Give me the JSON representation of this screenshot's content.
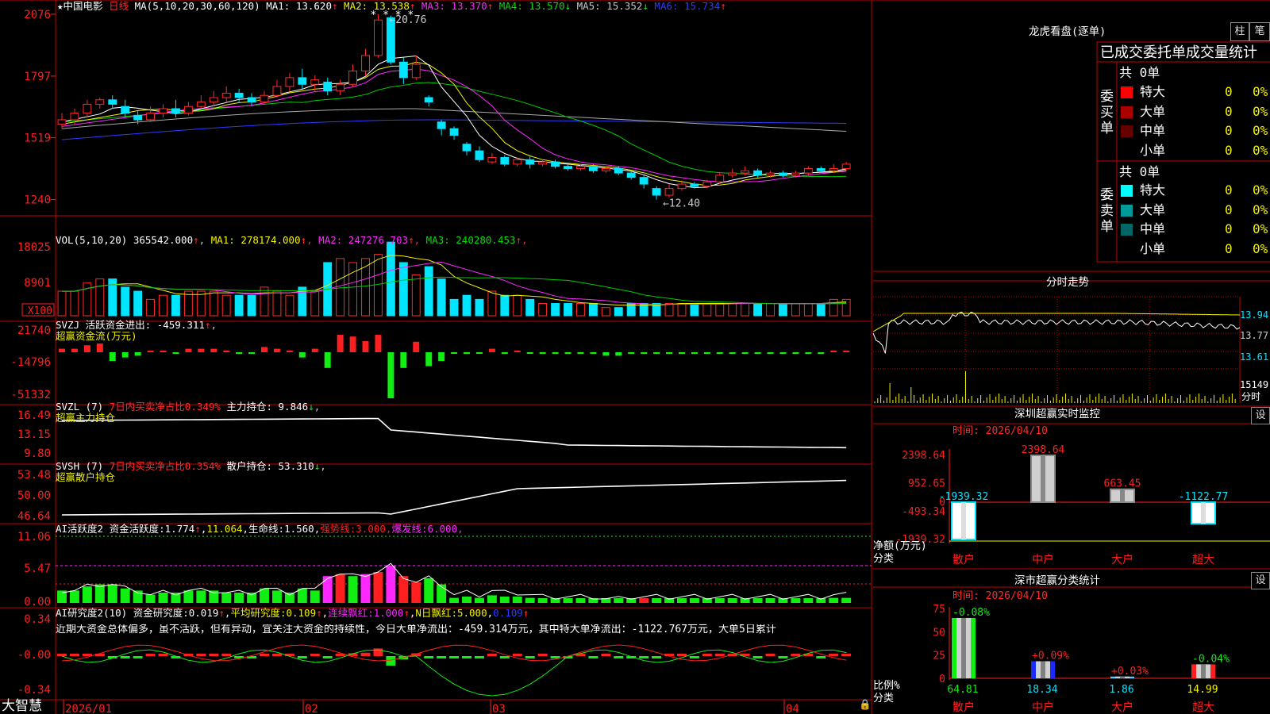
{
  "colors": {
    "up": "#ff2a2a",
    "down": "#00e5ff",
    "red": "#ff1f1f",
    "green": "#11ee11",
    "white": "#ffffff",
    "yellow": "#f3f300",
    "magenta": "#ff27ff",
    "ma_green": "#00cc00",
    "blue": "#2c3cff",
    "gray": "#aaaaaa",
    "grid": "#c00000"
  },
  "app": {
    "brand": "大智慧",
    "stock_name": "中国电影",
    "period": "日线",
    "star": "★",
    "lock": "🔒"
  },
  "main": {
    "ma_label": "MA(5,10,20,30,60,120)",
    "ma": [
      {
        "k": "MA1",
        "v": "13.620",
        "dir": "↑",
        "color": "#ffffff"
      },
      {
        "k": "MA2",
        "v": "13.538",
        "dir": "↑",
        "color": "#f3f300"
      },
      {
        "k": "MA3",
        "v": "13.370",
        "dir": "↑",
        "color": "#ff27ff"
      },
      {
        "k": "MA4",
        "v": "13.570",
        "dir": "↓",
        "color": "#00dd00"
      },
      {
        "k": "MA5",
        "v": "15.352",
        "dir": "↓",
        "color": "#c8c8c8"
      },
      {
        "k": "MA6",
        "v": "15.734",
        "dir": "↑",
        "color": "#2c3cff"
      }
    ],
    "yticks": [
      "2076",
      "1797",
      "1519",
      "1240"
    ],
    "high_label": "20.76",
    "low_label": "12.40",
    "stars": "* * * *"
  },
  "vol": {
    "title": "VOL(5,10,20)",
    "value": "365542.000",
    "dir": "↑",
    "ma": [
      {
        "k": "MA1",
        "v": "278174.000",
        "dir": "↑",
        "color": "#f3f300"
      },
      {
        "k": "MA2",
        "v": "247276.703",
        "dir": "↑",
        "color": "#ff27ff"
      },
      {
        "k": "MA3",
        "v": "240280.453",
        "dir": "↑",
        "color": "#00dd00"
      }
    ],
    "yticks": [
      "18025",
      "8901"
    ],
    "unit": "X100"
  },
  "svzj": {
    "title": "SVZJ",
    "desc": "活跃资金进出:",
    "value": "-459.311",
    "dir": "↑",
    "sub": "超赢资金流(万元)",
    "yticks": [
      "21740",
      "-14796",
      "-51332"
    ]
  },
  "svzl": {
    "title": "SVZL (7)",
    "desc": "7日内买卖净占比0.349%",
    "label": "主力持仓:",
    "value": "9.846",
    "dir": "↓",
    "sub": "超赢主力持仓",
    "yticks": [
      "16.49",
      "13.15",
      "9.80"
    ]
  },
  "svsh": {
    "title": "SVSH (7)",
    "desc": "7日内买卖净占比0.354%",
    "label": "散户持仓:",
    "value": "53.310",
    "dir": "↓",
    "sub": "超赢散户持仓",
    "yticks": [
      "53.48",
      "50.00",
      "46.64"
    ]
  },
  "ai1": {
    "title": "AI活跃度2",
    "items": [
      {
        "t": "资金活跃度:",
        "c": "#ffffff"
      },
      {
        "t": "1.774",
        "c": "#ffffff"
      },
      {
        "t": "↑",
        "c": "#ff2a2a"
      },
      {
        "t": ",",
        "c": "#ffffff"
      },
      {
        "t": "11.064",
        "c": "#f3f300"
      },
      {
        "t": ",",
        "c": "#ffffff"
      },
      {
        "t": "生命线:",
        "c": "#ffffff"
      },
      {
        "t": "1.560",
        "c": "#ffffff"
      },
      {
        "t": ",",
        "c": "#ffffff"
      },
      {
        "t": "强势线:",
        "c": "#ff1f1f"
      },
      {
        "t": "3.000",
        "c": "#ff1f1f"
      },
      {
        "t": ",",
        "c": "#ff1f1f"
      },
      {
        "t": "爆发线:",
        "c": "#ff27ff"
      },
      {
        "t": "6.000",
        "c": "#ff27ff"
      },
      {
        "t": ",",
        "c": "#ff27ff"
      }
    ],
    "yticks": [
      "11.06",
      "5.47",
      "0.00"
    ]
  },
  "ai2": {
    "title": "AI研究度2(10)",
    "items": [
      {
        "t": "资金研究度:",
        "c": "#ffffff"
      },
      {
        "t": "0.019",
        "c": "#ffffff"
      },
      {
        "t": "↑",
        "c": "#ff2a2a"
      },
      {
        "t": ",",
        "c": "#ffffff"
      },
      {
        "t": "平均研究度:",
        "c": "#f3f300"
      },
      {
        "t": "0.109",
        "c": "#f3f300"
      },
      {
        "t": "↑",
        "c": "#ff2a2a"
      },
      {
        "t": ",",
        "c": "#ffffff"
      },
      {
        "t": "连续飘红:",
        "c": "#ff27ff"
      },
      {
        "t": "1.000",
        "c": "#ff27ff"
      },
      {
        "t": "↑",
        "c": "#ff2a2a"
      },
      {
        "t": ",",
        "c": "#ffffff"
      },
      {
        "t": "N日飘红:",
        "c": "#f3f300"
      },
      {
        "t": "5.000",
        "c": "#f3f300"
      },
      {
        "t": ",",
        "c": "#ffffff"
      },
      {
        "t": "0.109",
        "c": "#2c3cff"
      },
      {
        "t": "↑",
        "c": "#ff2a2a"
      }
    ],
    "comment": "近期大资金总体偏多，虽不活跃，但有异动，宜关注大资金的持续性，今日大单净流出：-459.314万元，其中特大单净流出：-1122.767万元，大单5日累计",
    "yticks": [
      "0.34",
      "-0.00",
      "-0.34"
    ]
  },
  "dates": [
    "2026/01",
    "02",
    "03",
    "04"
  ],
  "right": {
    "dragon": {
      "title": "龙虎看盘(逐单)",
      "btn1": "柱",
      "btn2": "笔",
      "header": "已成交委托单成交量统计",
      "buy": {
        "side": "委买单",
        "total": "共 0单",
        "rows": [
          {
            "l": "特大",
            "n": "0",
            "p": "0%",
            "c": "#ff0000"
          },
          {
            "l": "大单",
            "n": "0",
            "p": "0%",
            "c": "#aa0000"
          },
          {
            "l": "中单",
            "n": "0",
            "p": "0%",
            "c": "#660000"
          },
          {
            "l": "小单",
            "n": "0",
            "p": "0%",
            "c": ""
          }
        ]
      },
      "sell": {
        "side": "委卖单",
        "total": "共 0单",
        "rows": [
          {
            "l": "特大",
            "n": "0",
            "p": "0%",
            "c": "#00ffff"
          },
          {
            "l": "大单",
            "n": "0",
            "p": "0%",
            "c": "#009999"
          },
          {
            "l": "中单",
            "n": "0",
            "p": "0%",
            "c": "#006666"
          },
          {
            "l": "小单",
            "n": "0",
            "p": "0%",
            "c": ""
          }
        ]
      }
    },
    "intraday": {
      "title": "分时走势",
      "prices": [
        "13.94",
        "13.77",
        "13.61"
      ],
      "vol": "15149",
      "vol_label": "分时"
    },
    "sz_monitor": {
      "title": "深圳超赢实时监控",
      "btn": "设",
      "time": "时间: 2026/04/10",
      "yticks": [
        "2398.64",
        "952.65",
        "0",
        "-493.34",
        "-1939.32"
      ],
      "unit": "净额(万元)",
      "cat_label": "分类",
      "cats": [
        "散户",
        "中户",
        "大户",
        "超大"
      ],
      "values": [
        -1939.32,
        2398.64,
        663.45,
        -1122.77
      ],
      "value_labels": [
        "-1939.32",
        "2398.64",
        "663.45",
        "-1122.77"
      ]
    },
    "sz_stats": {
      "title": "深市超赢分类统计",
      "btn": "设",
      "time": "时间: 2026/04/10",
      "yticks": [
        "75",
        "50",
        "25",
        "0"
      ],
      "unit": "比例%",
      "cat_label": "分类",
      "cats": [
        "散户",
        "中户",
        "大户",
        "超大"
      ],
      "values": [
        64.81,
        18.34,
        1.86,
        14.99
      ],
      "changes": [
        "-0.08%",
        "+0.09%",
        "+0.03%",
        "-0.04%"
      ],
      "value_labels": [
        "64.81",
        "18.34",
        "1.86",
        "14.99"
      ]
    }
  },
  "chart_data": {
    "type": "candlestick",
    "x_months": [
      "2026/01",
      "02",
      "03",
      "04"
    ],
    "candles": [
      [
        15.8,
        16.0,
        16.3,
        15.6
      ],
      [
        16.0,
        16.3,
        16.5,
        15.8
      ],
      [
        16.3,
        16.7,
        16.9,
        16.1
      ],
      [
        16.7,
        16.9,
        17.0,
        16.5
      ],
      [
        16.9,
        16.7,
        17.1,
        16.5
      ],
      [
        16.6,
        16.3,
        16.9,
        16.1
      ],
      [
        16.2,
        16.0,
        16.4,
        15.8
      ],
      [
        16.0,
        16.3,
        16.6,
        15.9
      ],
      [
        16.3,
        16.5,
        16.7,
        16.1
      ],
      [
        16.5,
        16.3,
        16.9,
        16.1
      ],
      [
        16.3,
        16.6,
        16.8,
        16.2
      ],
      [
        16.6,
        16.8,
        17.1,
        16.5
      ],
      [
        16.8,
        17.0,
        17.3,
        16.6
      ],
      [
        17.0,
        17.2,
        17.5,
        16.8
      ],
      [
        17.2,
        17.0,
        17.4,
        16.8
      ],
      [
        17.0,
        16.8,
        17.2,
        16.6
      ],
      [
        16.8,
        17.1,
        17.3,
        16.7
      ],
      [
        17.1,
        17.5,
        17.8,
        17.0
      ],
      [
        17.5,
        17.9,
        18.1,
        17.3
      ],
      [
        17.9,
        17.6,
        18.3,
        17.4
      ],
      [
        17.6,
        17.8,
        18.0,
        17.3
      ],
      [
        17.7,
        17.3,
        17.9,
        17.1
      ],
      [
        17.3,
        17.6,
        17.8,
        17.1
      ],
      [
        17.6,
        18.2,
        18.5,
        17.5
      ],
      [
        18.2,
        18.9,
        19.2,
        18.0
      ],
      [
        18.9,
        20.5,
        20.76,
        18.8
      ],
      [
        20.6,
        18.6,
        20.7,
        18.5
      ],
      [
        18.6,
        17.9,
        18.8,
        17.6
      ],
      [
        17.9,
        18.5,
        18.9,
        17.8
      ],
      [
        17.0,
        16.8,
        17.1,
        16.6
      ],
      [
        15.9,
        15.6,
        16.0,
        15.3
      ],
      [
        15.6,
        15.3,
        15.7,
        15.1
      ],
      [
        14.9,
        14.6,
        15.0,
        14.4
      ],
      [
        14.6,
        14.2,
        14.8,
        14.1
      ],
      [
        14.1,
        14.3,
        14.5,
        14.0
      ],
      [
        14.3,
        14.0,
        14.4,
        13.9
      ],
      [
        14.0,
        14.2,
        14.3,
        13.9
      ],
      [
        14.2,
        14.0,
        14.4,
        13.8
      ],
      [
        14.0,
        14.1,
        14.2,
        13.9
      ],
      [
        14.1,
        13.9,
        14.2,
        13.8
      ],
      [
        13.9,
        13.8,
        14.0,
        13.7
      ],
      [
        13.8,
        13.9,
        14.0,
        13.7
      ],
      [
        13.9,
        13.7,
        14.0,
        13.6
      ],
      [
        13.7,
        13.8,
        13.9,
        13.6
      ],
      [
        13.8,
        13.6,
        13.9,
        13.5
      ],
      [
        13.6,
        13.4,
        13.7,
        13.3
      ],
      [
        13.4,
        13.1,
        13.5,
        12.9
      ],
      [
        12.9,
        12.6,
        13.0,
        12.4
      ],
      [
        12.6,
        12.9,
        13.1,
        12.5
      ],
      [
        12.9,
        13.1,
        13.2,
        12.8
      ],
      [
        13.1,
        13.0,
        13.2,
        12.9
      ],
      [
        13.0,
        13.2,
        13.3,
        12.9
      ],
      [
        13.2,
        13.5,
        13.6,
        13.1
      ],
      [
        13.5,
        13.6,
        13.8,
        13.4
      ],
      [
        13.6,
        13.7,
        13.9,
        13.5
      ],
      [
        13.7,
        13.5,
        13.8,
        13.4
      ],
      [
        13.5,
        13.6,
        13.7,
        13.4
      ],
      [
        13.6,
        13.5,
        13.7,
        13.4
      ],
      [
        13.5,
        13.6,
        13.7,
        13.4
      ],
      [
        13.6,
        13.8,
        13.9,
        13.5
      ],
      [
        13.8,
        13.7,
        13.9,
        13.6
      ],
      [
        13.7,
        13.8,
        14.0,
        13.6
      ],
      [
        13.8,
        14.0,
        14.1,
        13.7
      ]
    ],
    "volume": [
      6,
      6,
      8,
      9,
      9,
      7,
      6,
      4,
      5,
      5,
      6,
      6,
      6,
      5,
      5,
      5,
      7,
      6,
      5,
      7,
      6,
      13,
      14,
      13,
      14,
      15,
      18,
      13,
      10,
      12,
      9,
      4,
      5,
      4,
      6,
      5,
      5,
      4,
      3,
      3,
      3,
      3,
      3,
      2,
      2,
      3,
      3,
      3,
      3,
      3,
      3,
      3,
      3,
      3,
      3,
      3,
      3,
      3,
      3,
      3,
      3,
      4,
      4
    ],
    "ma_ylim": [
      12.4,
      20.76
    ]
  }
}
